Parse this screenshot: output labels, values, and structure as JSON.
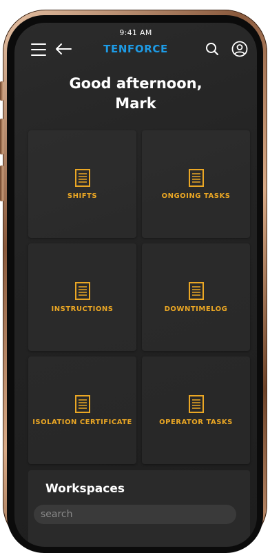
{
  "status": {
    "time": "9:41 AM"
  },
  "header": {
    "brand": "TENFORCE",
    "icons": {
      "menu": "menu-icon",
      "back": "arrow-left-icon",
      "search": "search-icon",
      "profile": "user-icon"
    }
  },
  "greeting": {
    "line1": "Good afternoon,",
    "line2": "Mark"
  },
  "tiles": [
    {
      "label": "SHIFTS",
      "icon": "document-icon"
    },
    {
      "label": "ONGOING TASKS",
      "icon": "document-icon"
    },
    {
      "label": "INSTRUCTIONS",
      "icon": "document-icon"
    },
    {
      "label": "DOWNTIMELOG",
      "icon": "document-icon"
    },
    {
      "label": "ISOLATION CERTIFICATE",
      "icon": "document-icon"
    },
    {
      "label": "OPERATOR TASKS",
      "icon": "document-icon"
    }
  ],
  "workspaces": {
    "title": "Workspaces",
    "search_placeholder": "search"
  },
  "colors": {
    "brand": "#1d9be6",
    "accent": "#eba724",
    "background": "#232323"
  }
}
